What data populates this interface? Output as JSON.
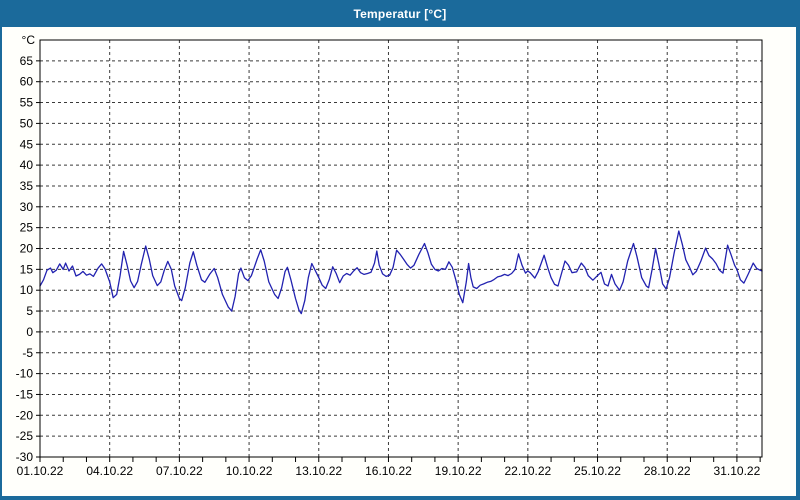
{
  "window": {
    "title": "Temperatur [°C]"
  },
  "colors": {
    "titlebar_bg": "#1b6a9b",
    "frame": "#1b6a9b",
    "title_text": "#ffffff",
    "panel_bg": "#fffffb",
    "plot_bg": "#ffffff",
    "plot_border": "#000000",
    "grid": "#3a3a3a",
    "tick": "#000000",
    "label_text": "#000000",
    "line": "#2222b0"
  },
  "chart_data": {
    "type": "line",
    "title": "Temperatur [°C]",
    "ylabel": "°C",
    "ylim": [
      -30,
      70
    ],
    "yticks": [
      65,
      60,
      55,
      50,
      45,
      40,
      35,
      30,
      25,
      20,
      15,
      10,
      5,
      0,
      -5,
      -10,
      -15,
      -20,
      -25,
      -30
    ],
    "xlim_days": [
      0,
      31.08
    ],
    "x_minor_tick_days": 1,
    "grid": "dashed",
    "legend": "none",
    "xticks": [
      {
        "pos": 0,
        "label": "01.10.22"
      },
      {
        "pos": 3,
        "label": "04.10.22"
      },
      {
        "pos": 6,
        "label": "07.10.22"
      },
      {
        "pos": 9,
        "label": "10.10.22"
      },
      {
        "pos": 12,
        "label": "13.10.22"
      },
      {
        "pos": 15,
        "label": "16.10.22"
      },
      {
        "pos": 18,
        "label": "19.10.22"
      },
      {
        "pos": 21,
        "label": "22.10.22"
      },
      {
        "pos": 24,
        "label": "25.10.22"
      },
      {
        "pos": 27,
        "label": "28.10.22"
      },
      {
        "pos": 30,
        "label": "31.10.22"
      }
    ],
    "series": [
      {
        "name": "Temperatur",
        "points": [
          [
            0,
            11
          ],
          [
            0.15,
            12.5
          ],
          [
            0.3,
            14.8
          ],
          [
            0.45,
            15.3
          ],
          [
            0.55,
            14.2
          ],
          [
            0.7,
            14.8
          ],
          [
            0.85,
            16.3
          ],
          [
            1,
            15
          ],
          [
            1.1,
            16.5
          ],
          [
            1.25,
            14.6
          ],
          [
            1.4,
            15.8
          ],
          [
            1.55,
            13.4
          ],
          [
            1.7,
            13.8
          ],
          [
            1.85,
            14.5
          ],
          [
            2,
            13.6
          ],
          [
            2.15,
            13.9
          ],
          [
            2.3,
            13.3
          ],
          [
            2.5,
            15.3
          ],
          [
            2.65,
            16.3
          ],
          [
            2.8,
            15.1
          ],
          [
            3,
            12
          ],
          [
            3.15,
            8.2
          ],
          [
            3.3,
            9
          ],
          [
            3.45,
            13.5
          ],
          [
            3.6,
            19.3
          ],
          [
            3.75,
            16
          ],
          [
            3.9,
            12.2
          ],
          [
            4.05,
            10.6
          ],
          [
            4.2,
            12.1
          ],
          [
            4.35,
            16
          ],
          [
            4.55,
            20.6
          ],
          [
            4.7,
            17.5
          ],
          [
            4.85,
            13.5
          ],
          [
            5.05,
            11.1
          ],
          [
            5.2,
            12
          ],
          [
            5.35,
            14.8
          ],
          [
            5.5,
            16.9
          ],
          [
            5.65,
            15
          ],
          [
            5.8,
            11
          ],
          [
            6,
            8
          ],
          [
            6.1,
            7.5
          ],
          [
            6.25,
            10.5
          ],
          [
            6.45,
            16.5
          ],
          [
            6.6,
            19.2
          ],
          [
            6.75,
            16
          ],
          [
            6.95,
            12.5
          ],
          [
            7.1,
            11.9
          ],
          [
            7.3,
            13.8
          ],
          [
            7.5,
            15.2
          ],
          [
            7.65,
            13
          ],
          [
            7.85,
            9
          ],
          [
            8.1,
            6
          ],
          [
            8.25,
            5
          ],
          [
            8.4,
            8.5
          ],
          [
            8.55,
            14
          ],
          [
            8.65,
            15.3
          ],
          [
            8.8,
            13
          ],
          [
            8.95,
            12.3
          ],
          [
            9.1,
            13.5
          ],
          [
            9.35,
            17.5
          ],
          [
            9.5,
            19.7
          ],
          [
            9.65,
            17
          ],
          [
            9.85,
            12
          ],
          [
            10.1,
            9
          ],
          [
            10.25,
            8
          ],
          [
            10.4,
            10.5
          ],
          [
            10.55,
            14.5
          ],
          [
            10.65,
            15.5
          ],
          [
            10.8,
            12.5
          ],
          [
            11,
            8
          ],
          [
            11.15,
            5.2
          ],
          [
            11.25,
            4.4
          ],
          [
            11.4,
            7.5
          ],
          [
            11.55,
            13
          ],
          [
            11.7,
            16.4
          ],
          [
            11.85,
            14.7
          ],
          [
            12,
            13
          ],
          [
            12.15,
            11.2
          ],
          [
            12.3,
            10.4
          ],
          [
            12.45,
            12.5
          ],
          [
            12.6,
            15.6
          ],
          [
            12.75,
            14
          ],
          [
            12.9,
            11.8
          ],
          [
            13.05,
            13.4
          ],
          [
            13.2,
            14
          ],
          [
            13.35,
            13.6
          ],
          [
            13.5,
            14.6
          ],
          [
            13.65,
            15.4
          ],
          [
            13.8,
            14.2
          ],
          [
            13.95,
            13.8
          ],
          [
            14.1,
            14
          ],
          [
            14.25,
            14.3
          ],
          [
            14.4,
            16.5
          ],
          [
            14.5,
            19.4
          ],
          [
            14.6,
            16
          ],
          [
            14.75,
            13.9
          ],
          [
            14.9,
            13.3
          ],
          [
            15.05,
            13.6
          ],
          [
            15.2,
            15.5
          ],
          [
            15.35,
            19.6
          ],
          [
            15.5,
            18.6
          ],
          [
            15.65,
            17.4
          ],
          [
            15.8,
            16.2
          ],
          [
            15.95,
            15.3
          ],
          [
            16.1,
            16
          ],
          [
            16.3,
            18.5
          ],
          [
            16.55,
            21.2
          ],
          [
            16.7,
            19
          ],
          [
            16.85,
            16.2
          ],
          [
            17,
            15
          ],
          [
            17.15,
            14.6
          ],
          [
            17.3,
            15.2
          ],
          [
            17.45,
            15
          ],
          [
            17.6,
            16.8
          ],
          [
            17.75,
            15.5
          ],
          [
            17.9,
            12.5
          ],
          [
            18.05,
            9
          ],
          [
            18.2,
            7
          ],
          [
            18.35,
            12
          ],
          [
            18.45,
            16.4
          ],
          [
            18.55,
            13
          ],
          [
            18.65,
            10.8
          ],
          [
            18.8,
            10.4
          ],
          [
            18.95,
            11.2
          ],
          [
            19.1,
            11.5
          ],
          [
            19.25,
            11.9
          ],
          [
            19.4,
            12.1
          ],
          [
            19.55,
            12.6
          ],
          [
            19.7,
            13.2
          ],
          [
            19.85,
            13.4
          ],
          [
            20,
            13.8
          ],
          [
            20.15,
            13.5
          ],
          [
            20.3,
            14
          ],
          [
            20.45,
            15
          ],
          [
            20.6,
            18.7
          ],
          [
            20.75,
            16
          ],
          [
            20.9,
            14.1
          ],
          [
            21,
            14.6
          ],
          [
            21.1,
            14.2
          ],
          [
            21.3,
            12.9
          ],
          [
            21.45,
            14.5
          ],
          [
            21.7,
            18.4
          ],
          [
            21.85,
            15.5
          ],
          [
            22,
            13
          ],
          [
            22.15,
            11.4
          ],
          [
            22.3,
            11
          ],
          [
            22.45,
            14
          ],
          [
            22.6,
            17
          ],
          [
            22.75,
            16
          ],
          [
            22.9,
            14.2
          ],
          [
            23.1,
            14.4
          ],
          [
            23.3,
            16.5
          ],
          [
            23.45,
            15.5
          ],
          [
            23.6,
            13.5
          ],
          [
            23.8,
            12.4
          ],
          [
            24,
            13.5
          ],
          [
            24.15,
            14.3
          ],
          [
            24.3,
            11.5
          ],
          [
            24.45,
            11
          ],
          [
            24.6,
            13.8
          ],
          [
            24.75,
            11.5
          ],
          [
            24.95,
            10
          ],
          [
            25.1,
            12
          ],
          [
            25.3,
            17
          ],
          [
            25.55,
            21.2
          ],
          [
            25.7,
            18
          ],
          [
            25.9,
            13
          ],
          [
            26.1,
            11
          ],
          [
            26.2,
            10.6
          ],
          [
            26.35,
            15
          ],
          [
            26.5,
            20
          ],
          [
            26.65,
            16
          ],
          [
            26.8,
            11.5
          ],
          [
            26.95,
            10.3
          ],
          [
            27.1,
            13
          ],
          [
            27.3,
            19
          ],
          [
            27.5,
            24.2
          ],
          [
            27.65,
            21
          ],
          [
            27.8,
            17.3
          ],
          [
            27.95,
            15.6
          ],
          [
            28.1,
            13.7
          ],
          [
            28.25,
            14.5
          ],
          [
            28.45,
            17
          ],
          [
            28.65,
            20.1
          ],
          [
            28.8,
            18.3
          ],
          [
            28.95,
            17.5
          ],
          [
            29.1,
            16.4
          ],
          [
            29.25,
            14.8
          ],
          [
            29.4,
            14.1
          ],
          [
            29.6,
            20.8
          ],
          [
            29.75,
            18.5
          ],
          [
            29.9,
            16
          ],
          [
            30,
            15
          ],
          [
            30.15,
            12.5
          ],
          [
            30.3,
            11.7
          ],
          [
            30.5,
            14
          ],
          [
            30.7,
            16.5
          ],
          [
            30.85,
            15.2
          ],
          [
            31,
            14.8
          ],
          [
            31.08,
            14.6
          ]
        ]
      }
    ]
  }
}
